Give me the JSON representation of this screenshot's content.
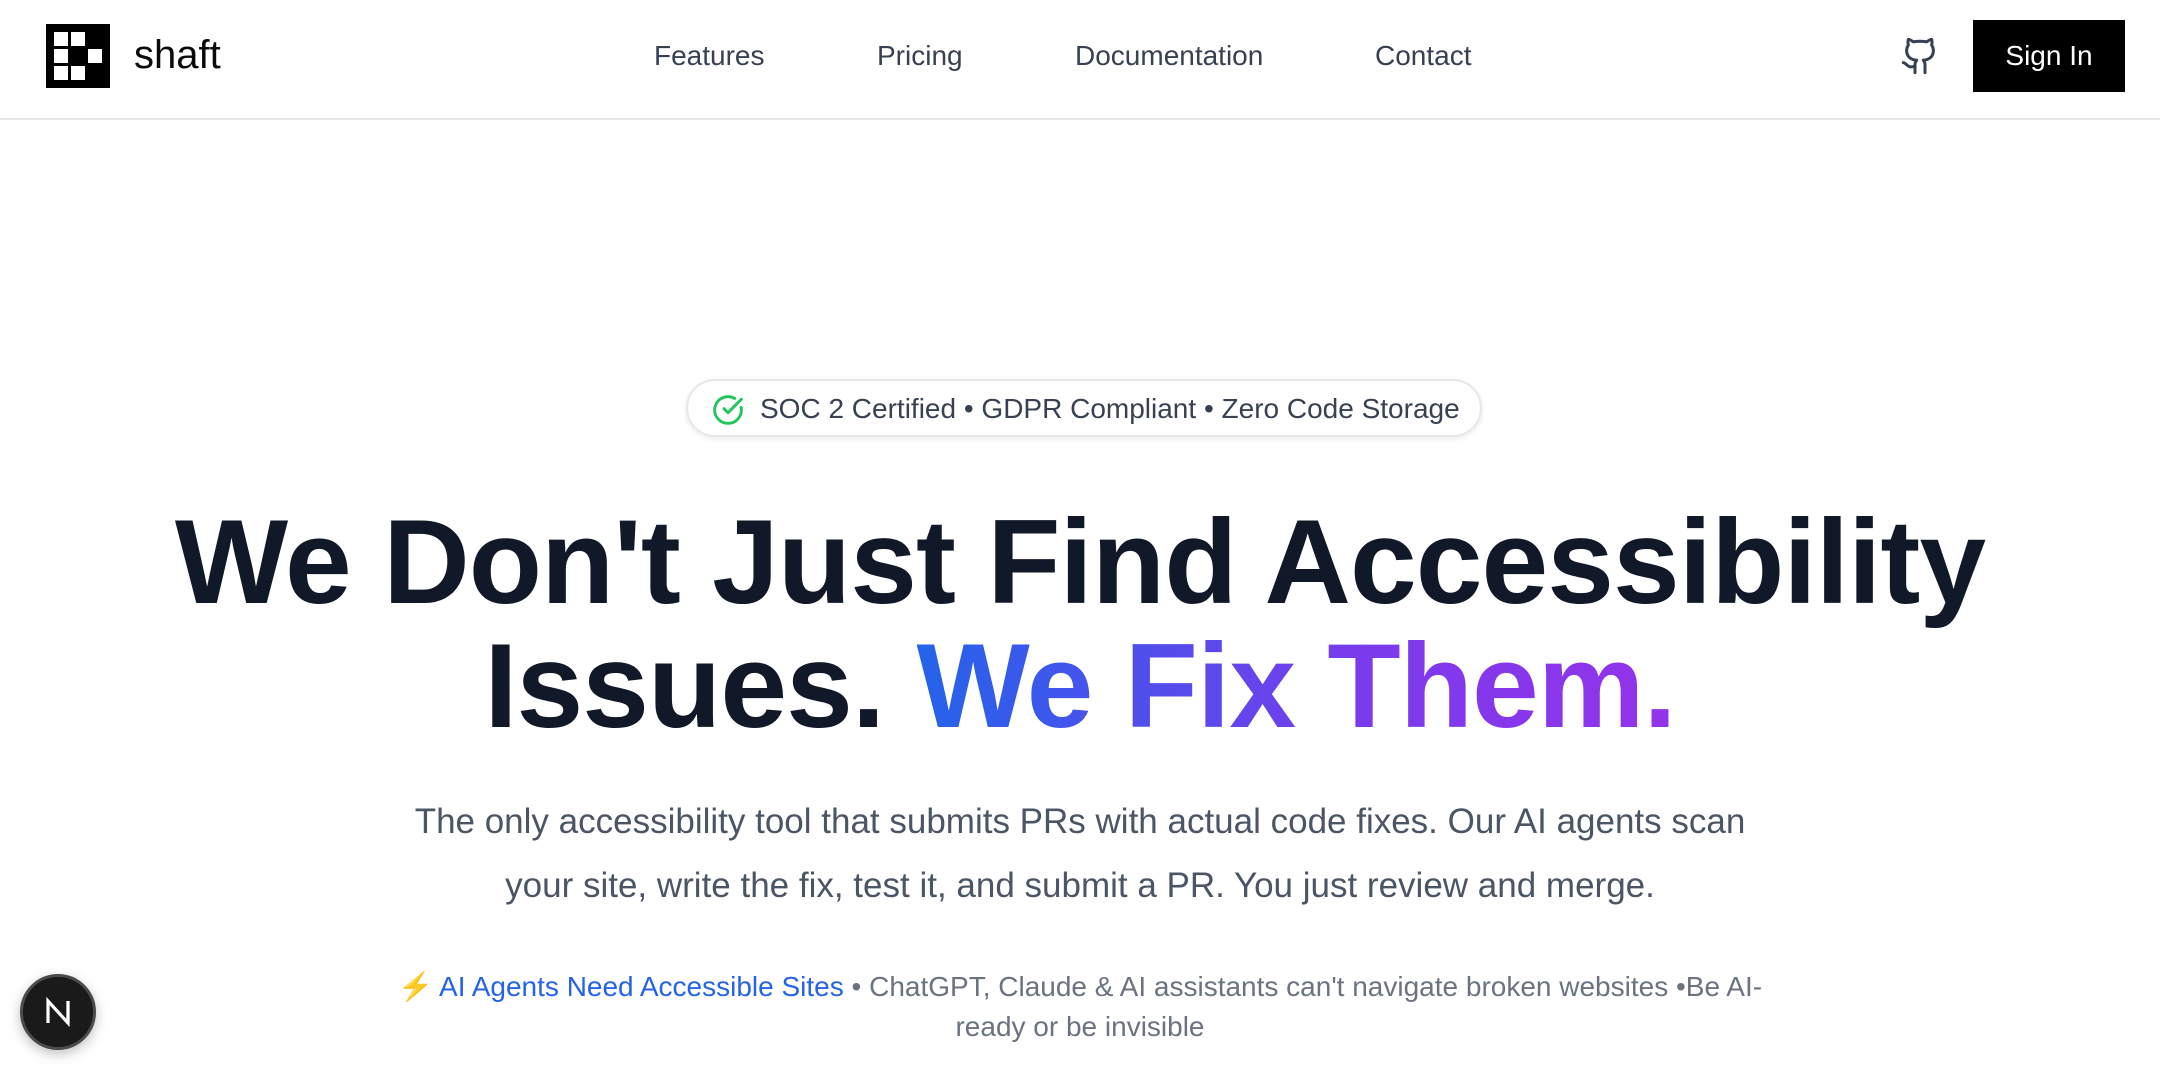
{
  "header": {
    "logo_text": "shaft",
    "logo_icon": "checker-logo-icon",
    "nav": [
      {
        "label": "Features"
      },
      {
        "label": "Pricing"
      },
      {
        "label": "Documentation"
      },
      {
        "label": "Contact"
      }
    ],
    "github_icon": "github-icon",
    "signin_label": "Sign In"
  },
  "badge": {
    "icon": "check-circle-icon",
    "text": "SOC 2 Certified • GDPR Compliant • Zero Code Storage"
  },
  "hero": {
    "line1": "We Don't Just Find Accessibility",
    "line2_plain": "Issues. ",
    "line2_gradient": "We Fix Them."
  },
  "subtitle": "The only accessibility tool that submits PRs with actual code fixes. Our AI agents scan your site, write the fix, test it, and submit a PR. You just review and merge.",
  "notice": {
    "bolt": "⚡",
    "link_text": "AI Agents Need Accessible Sites",
    "rest_text": " • ChatGPT, Claude & AI assistants can't navigate broken websites •Be AI-ready or be invisible"
  },
  "dev_button": {
    "icon": "nextjs-n-icon",
    "letter": "N"
  },
  "colors": {
    "accent_blue": "#2563eb",
    "accent_purple": "#9333ea",
    "badge_check": "#22c55e",
    "signin_bg": "#000000"
  }
}
